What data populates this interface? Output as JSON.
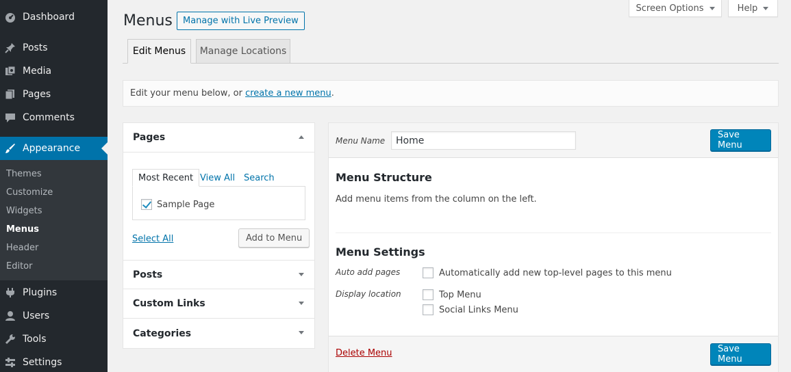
{
  "sidebar": {
    "items": [
      {
        "label": "Dashboard",
        "icon": "dashboard-icon"
      },
      {
        "label": "Posts",
        "icon": "pin-icon"
      },
      {
        "label": "Media",
        "icon": "media-icon"
      },
      {
        "label": "Pages",
        "icon": "pages-icon"
      },
      {
        "label": "Comments",
        "icon": "comment-icon"
      },
      {
        "label": "Appearance",
        "icon": "brush-icon"
      },
      {
        "label": "Plugins",
        "icon": "plugin-icon"
      },
      {
        "label": "Users",
        "icon": "users-icon"
      },
      {
        "label": "Tools",
        "icon": "wrench-icon"
      },
      {
        "label": "Settings",
        "icon": "settings-icon"
      }
    ],
    "submenu": [
      "Themes",
      "Customize",
      "Widgets",
      "Menus",
      "Header",
      "Editor"
    ]
  },
  "screen_meta": {
    "screen_options": "Screen Options",
    "help": "Help"
  },
  "header": {
    "title": "Menus",
    "live_preview": "Manage with Live Preview"
  },
  "tabs": {
    "edit": "Edit Menus",
    "manage": "Manage Locations"
  },
  "notice": {
    "prefix": "Edit your menu below, or ",
    "link": "create a new menu",
    "suffix": "."
  },
  "accordion": {
    "pages": {
      "title": "Pages",
      "tabs": [
        "Most Recent",
        "View All",
        "Search"
      ],
      "item": "Sample Page",
      "select_all": "Select All",
      "add_button": "Add to Menu"
    },
    "sections": [
      "Posts",
      "Custom Links",
      "Categories"
    ]
  },
  "menu": {
    "name_label": "Menu Name",
    "name_value": "Home",
    "save": "Save Menu",
    "structure_title": "Menu Structure",
    "structure_desc": "Add menu items from the column on the left.",
    "settings_title": "Menu Settings",
    "auto_add_label": "Auto add pages",
    "auto_add_option": "Automatically add new top-level pages to this menu",
    "display_location_label": "Display location",
    "locations": [
      "Top Menu",
      "Social Links Menu"
    ],
    "delete": "Delete Menu"
  },
  "colors": {
    "admin_bar": "#23282d",
    "accent": "#0073aa",
    "primary_button": "#0085ba",
    "delete": "#a00"
  }
}
